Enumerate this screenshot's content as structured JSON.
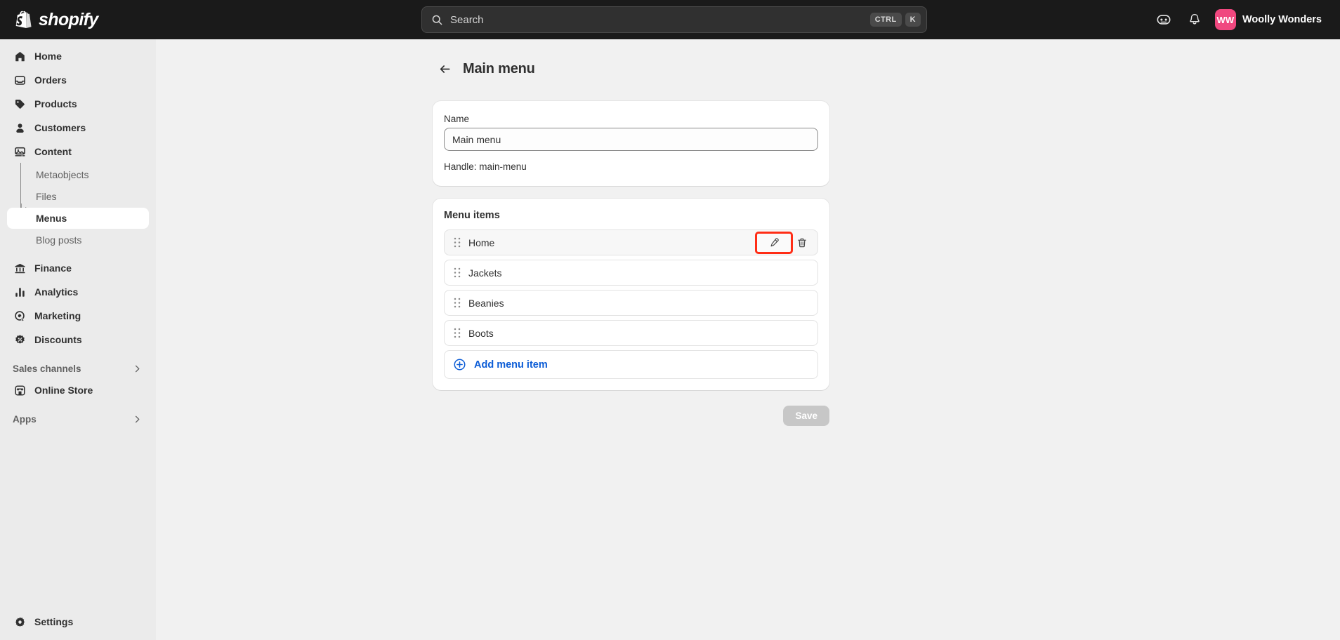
{
  "topbar": {
    "brand": "shopify",
    "search": {
      "placeholder": "Search",
      "kbd_mod": "CTRL",
      "kbd_key": "K"
    },
    "store_icon": "store-face-icon",
    "notifications_icon": "bell-icon",
    "user": {
      "initials": "WW",
      "name": "Woolly Wonders",
      "avatar_color": "#f0487f"
    }
  },
  "sidebar": {
    "items": [
      {
        "label": "Home",
        "icon": "home-icon"
      },
      {
        "label": "Orders",
        "icon": "orders-icon"
      },
      {
        "label": "Products",
        "icon": "tag-icon"
      },
      {
        "label": "Customers",
        "icon": "person-icon"
      },
      {
        "label": "Content",
        "icon": "content-image-icon"
      }
    ],
    "content_children": [
      {
        "label": "Metaobjects",
        "active": false
      },
      {
        "label": "Files",
        "active": false
      },
      {
        "label": "Menus",
        "active": true
      },
      {
        "label": "Blog posts",
        "active": false
      }
    ],
    "items_lower": [
      {
        "label": "Finance",
        "icon": "bank-icon"
      },
      {
        "label": "Analytics",
        "icon": "bar-chart-icon"
      },
      {
        "label": "Marketing",
        "icon": "marketing-target-icon"
      },
      {
        "label": "Discounts",
        "icon": "discount-badge-icon"
      }
    ],
    "sales_channels": {
      "title": "Sales channels",
      "chevron": "chevron-right-icon"
    },
    "channels": [
      {
        "label": "Online Store",
        "icon": "storefront-icon"
      }
    ],
    "apps": {
      "title": "Apps",
      "chevron": "chevron-right-icon"
    },
    "settings": {
      "label": "Settings",
      "icon": "gear-icon"
    }
  },
  "page": {
    "back_icon": "arrow-left-icon",
    "title": "Main menu",
    "name_card": {
      "label": "Name",
      "value": "Main menu",
      "placeholder": "Main menu",
      "handle": "Handle: main-menu"
    },
    "items_card": {
      "title": "Menu items",
      "rows": [
        {
          "label": "Home",
          "edit_icon": "pencil-icon",
          "delete_icon": "trash-icon",
          "highlighted": true
        },
        {
          "label": "Jackets"
        },
        {
          "label": "Beanies"
        },
        {
          "label": "Boots"
        }
      ],
      "add_label": "Add menu item",
      "add_icon": "circle-plus-icon"
    },
    "save_label": "Save",
    "highlight_color": "#ff2d16"
  }
}
